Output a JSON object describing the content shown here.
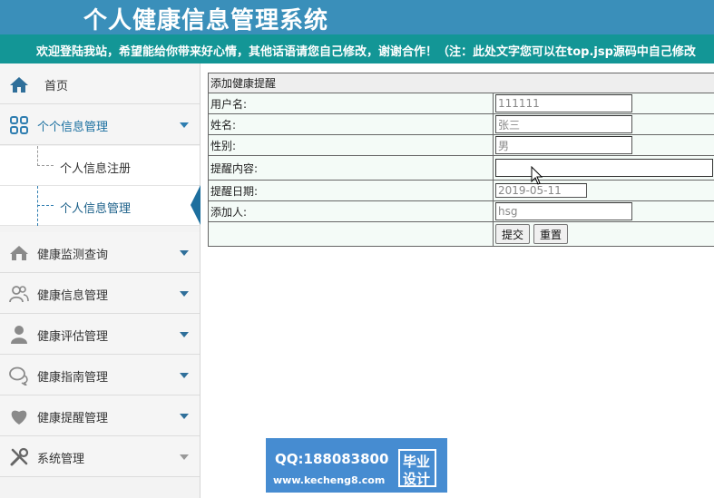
{
  "header": {
    "title": "个人健康信息管理系统",
    "marquee": "欢迎登陆我站，希望能给你带来好心情，其他话语请您自己修改，谢谢合作！（注：此处文字您可以在top.jsp源码中自己修改"
  },
  "sidebar": {
    "items": [
      {
        "label": "首页",
        "icon": "home-icon"
      },
      {
        "label": "个个信息管理",
        "icon": "grid-icon"
      },
      {
        "label": "健康监测查询",
        "icon": "house-icon"
      },
      {
        "label": "健康信息管理",
        "icon": "users-icon"
      },
      {
        "label": "健康评估管理",
        "icon": "user-icon"
      },
      {
        "label": "健康指南管理",
        "icon": "chat-icon"
      },
      {
        "label": "健康提醒管理",
        "icon": "heart-icon"
      },
      {
        "label": "系统管理",
        "icon": "tools-icon"
      }
    ],
    "subitems": [
      {
        "label": "个人信息注册"
      },
      {
        "label": "个人信息管理"
      }
    ]
  },
  "form": {
    "caption": "添加健康提醒",
    "fields": [
      {
        "label": "用户名:",
        "value": "111111"
      },
      {
        "label": "姓名:",
        "value": "张三"
      },
      {
        "label": "性别:",
        "value": "男"
      },
      {
        "label": "提醒内容:",
        "value": ""
      },
      {
        "label": "提醒日期:",
        "value": "2019-05-11"
      },
      {
        "label": "添加人:",
        "value": "hsg"
      }
    ],
    "submit_label": "提交",
    "reset_label": "重置"
  },
  "watermark": {
    "qq": "QQ:188083800",
    "url": "www.kecheng8.com",
    "line1": "毕业",
    "line2": "设计"
  },
  "colors": {
    "header": "#3a8fba",
    "marquee": "#139696",
    "accent": "#1d6f9e"
  }
}
